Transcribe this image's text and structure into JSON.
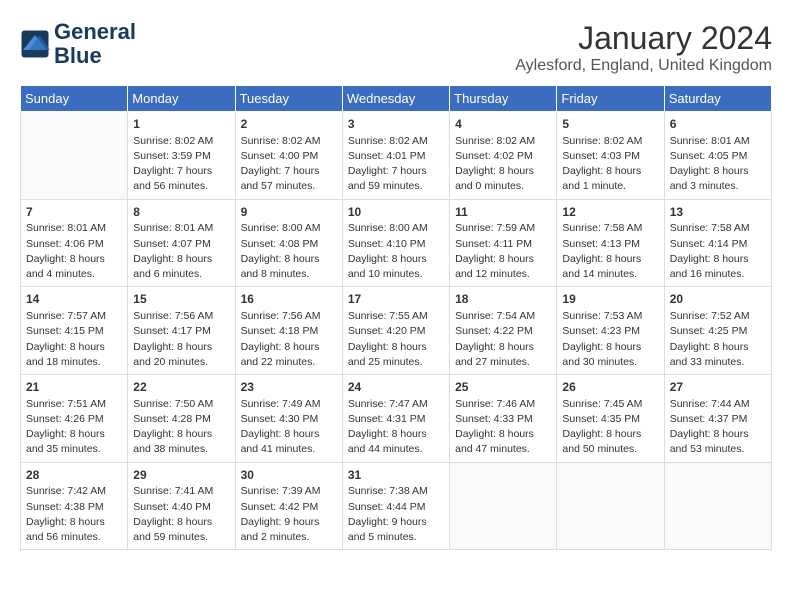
{
  "header": {
    "logo_line1": "General",
    "logo_line2": "Blue",
    "title": "January 2024",
    "location": "Aylesford, England, United Kingdom"
  },
  "days_of_week": [
    "Sunday",
    "Monday",
    "Tuesday",
    "Wednesday",
    "Thursday",
    "Friday",
    "Saturday"
  ],
  "weeks": [
    [
      {
        "day": "",
        "info": ""
      },
      {
        "day": "1",
        "info": "Sunrise: 8:02 AM\nSunset: 3:59 PM\nDaylight: 7 hours\nand 56 minutes."
      },
      {
        "day": "2",
        "info": "Sunrise: 8:02 AM\nSunset: 4:00 PM\nDaylight: 7 hours\nand 57 minutes."
      },
      {
        "day": "3",
        "info": "Sunrise: 8:02 AM\nSunset: 4:01 PM\nDaylight: 7 hours\nand 59 minutes."
      },
      {
        "day": "4",
        "info": "Sunrise: 8:02 AM\nSunset: 4:02 PM\nDaylight: 8 hours\nand 0 minutes."
      },
      {
        "day": "5",
        "info": "Sunrise: 8:02 AM\nSunset: 4:03 PM\nDaylight: 8 hours\nand 1 minute."
      },
      {
        "day": "6",
        "info": "Sunrise: 8:01 AM\nSunset: 4:05 PM\nDaylight: 8 hours\nand 3 minutes."
      }
    ],
    [
      {
        "day": "7",
        "info": "Sunrise: 8:01 AM\nSunset: 4:06 PM\nDaylight: 8 hours\nand 4 minutes."
      },
      {
        "day": "8",
        "info": "Sunrise: 8:01 AM\nSunset: 4:07 PM\nDaylight: 8 hours\nand 6 minutes."
      },
      {
        "day": "9",
        "info": "Sunrise: 8:00 AM\nSunset: 4:08 PM\nDaylight: 8 hours\nand 8 minutes."
      },
      {
        "day": "10",
        "info": "Sunrise: 8:00 AM\nSunset: 4:10 PM\nDaylight: 8 hours\nand 10 minutes."
      },
      {
        "day": "11",
        "info": "Sunrise: 7:59 AM\nSunset: 4:11 PM\nDaylight: 8 hours\nand 12 minutes."
      },
      {
        "day": "12",
        "info": "Sunrise: 7:58 AM\nSunset: 4:13 PM\nDaylight: 8 hours\nand 14 minutes."
      },
      {
        "day": "13",
        "info": "Sunrise: 7:58 AM\nSunset: 4:14 PM\nDaylight: 8 hours\nand 16 minutes."
      }
    ],
    [
      {
        "day": "14",
        "info": "Sunrise: 7:57 AM\nSunset: 4:15 PM\nDaylight: 8 hours\nand 18 minutes."
      },
      {
        "day": "15",
        "info": "Sunrise: 7:56 AM\nSunset: 4:17 PM\nDaylight: 8 hours\nand 20 minutes."
      },
      {
        "day": "16",
        "info": "Sunrise: 7:56 AM\nSunset: 4:18 PM\nDaylight: 8 hours\nand 22 minutes."
      },
      {
        "day": "17",
        "info": "Sunrise: 7:55 AM\nSunset: 4:20 PM\nDaylight: 8 hours\nand 25 minutes."
      },
      {
        "day": "18",
        "info": "Sunrise: 7:54 AM\nSunset: 4:22 PM\nDaylight: 8 hours\nand 27 minutes."
      },
      {
        "day": "19",
        "info": "Sunrise: 7:53 AM\nSunset: 4:23 PM\nDaylight: 8 hours\nand 30 minutes."
      },
      {
        "day": "20",
        "info": "Sunrise: 7:52 AM\nSunset: 4:25 PM\nDaylight: 8 hours\nand 33 minutes."
      }
    ],
    [
      {
        "day": "21",
        "info": "Sunrise: 7:51 AM\nSunset: 4:26 PM\nDaylight: 8 hours\nand 35 minutes."
      },
      {
        "day": "22",
        "info": "Sunrise: 7:50 AM\nSunset: 4:28 PM\nDaylight: 8 hours\nand 38 minutes."
      },
      {
        "day": "23",
        "info": "Sunrise: 7:49 AM\nSunset: 4:30 PM\nDaylight: 8 hours\nand 41 minutes."
      },
      {
        "day": "24",
        "info": "Sunrise: 7:47 AM\nSunset: 4:31 PM\nDaylight: 8 hours\nand 44 minutes."
      },
      {
        "day": "25",
        "info": "Sunrise: 7:46 AM\nSunset: 4:33 PM\nDaylight: 8 hours\nand 47 minutes."
      },
      {
        "day": "26",
        "info": "Sunrise: 7:45 AM\nSunset: 4:35 PM\nDaylight: 8 hours\nand 50 minutes."
      },
      {
        "day": "27",
        "info": "Sunrise: 7:44 AM\nSunset: 4:37 PM\nDaylight: 8 hours\nand 53 minutes."
      }
    ],
    [
      {
        "day": "28",
        "info": "Sunrise: 7:42 AM\nSunset: 4:38 PM\nDaylight: 8 hours\nand 56 minutes."
      },
      {
        "day": "29",
        "info": "Sunrise: 7:41 AM\nSunset: 4:40 PM\nDaylight: 8 hours\nand 59 minutes."
      },
      {
        "day": "30",
        "info": "Sunrise: 7:39 AM\nSunset: 4:42 PM\nDaylight: 9 hours\nand 2 minutes."
      },
      {
        "day": "31",
        "info": "Sunrise: 7:38 AM\nSunset: 4:44 PM\nDaylight: 9 hours\nand 5 minutes."
      },
      {
        "day": "",
        "info": ""
      },
      {
        "day": "",
        "info": ""
      },
      {
        "day": "",
        "info": ""
      }
    ]
  ]
}
